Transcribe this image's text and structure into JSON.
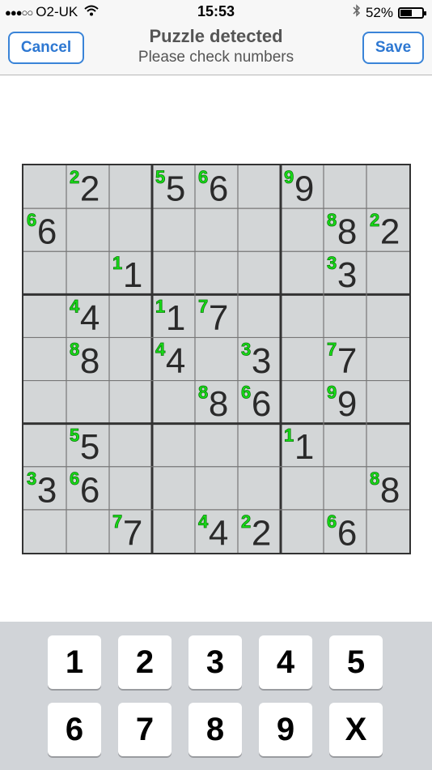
{
  "status_bar": {
    "signal_dots": "●●●○○",
    "carrier": "O2-UK",
    "wifi_icon": "wifi-icon",
    "time": "15:53",
    "bluetooth_icon": "bluetooth-icon",
    "battery": "52%"
  },
  "nav": {
    "cancel_label": "Cancel",
    "title": "Puzzle detected",
    "subtitle": "Please check numbers",
    "save_label": "Save"
  },
  "colors": {
    "accent": "#2e78d2",
    "detected_digit": "#18e018",
    "printed_digit": "#2a2a2a",
    "grid_paper": "#d3d6d7",
    "keypad_bg": "#d1d4d8"
  },
  "puzzle": {
    "grid": [
      [
        0,
        2,
        0,
        5,
        6,
        0,
        9,
        0,
        0
      ],
      [
        6,
        0,
        0,
        0,
        0,
        0,
        0,
        8,
        2
      ],
      [
        0,
        0,
        1,
        0,
        0,
        0,
        0,
        3,
        0
      ],
      [
        0,
        4,
        0,
        1,
        7,
        0,
        0,
        0,
        0
      ],
      [
        0,
        8,
        0,
        4,
        0,
        3,
        0,
        7,
        0
      ],
      [
        0,
        0,
        0,
        0,
        8,
        6,
        0,
        9,
        0
      ],
      [
        0,
        5,
        0,
        0,
        0,
        0,
        1,
        0,
        0
      ],
      [
        3,
        6,
        0,
        0,
        0,
        0,
        0,
        0,
        8
      ],
      [
        0,
        0,
        7,
        0,
        4,
        2,
        0,
        6,
        0
      ]
    ]
  },
  "keypad": {
    "keys": [
      "1",
      "2",
      "3",
      "4",
      "5",
      "6",
      "7",
      "8",
      "9",
      "X"
    ]
  }
}
